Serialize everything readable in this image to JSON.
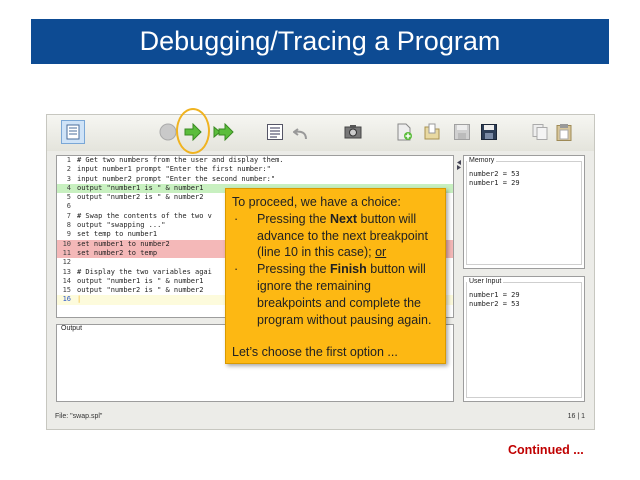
{
  "slide": {
    "title": "Debugging/Tracing a Program",
    "continued": "Continued ..."
  },
  "toolbar": {
    "icons": [
      "list-view-icon",
      "stop-icon",
      "next-icon",
      "finish-icon",
      "source-listing-icon",
      "undo-icon",
      "screenshot-icon",
      "new-file-icon",
      "open-file-icon",
      "save-icon",
      "save-as-icon",
      "copy-icon",
      "paste-icon"
    ],
    "highlighted": "next-icon",
    "highlight_color": "#f0b320"
  },
  "editor": {
    "lines": [
      {
        "n": "1",
        "text": "# Get two numbers from the user and display them.",
        "hl": ""
      },
      {
        "n": "2",
        "text": "input number1 prompt \"Enter the first number:\"",
        "hl": ""
      },
      {
        "n": "3",
        "text": "input number2 prompt \"Enter the second number:\"",
        "hl": ""
      },
      {
        "n": "4",
        "text": "output \"number1 is \" & number1",
        "hl": "green"
      },
      {
        "n": "5",
        "text": "output \"number2 is \" & number2",
        "hl": ""
      },
      {
        "n": "6",
        "text": "",
        "hl": ""
      },
      {
        "n": "7",
        "text": "# Swap the contents of the two v",
        "hl": ""
      },
      {
        "n": "8",
        "text": "output \"swapping ...\"",
        "hl": ""
      },
      {
        "n": "9",
        "text": "set temp to number1",
        "hl": ""
      },
      {
        "n": "10",
        "text": "set number1 to number2",
        "hl": "red"
      },
      {
        "n": "11",
        "text": "set number2 to temp",
        "hl": "red"
      },
      {
        "n": "12",
        "text": "",
        "hl": ""
      },
      {
        "n": "13",
        "text": "# Display the two variables agai",
        "hl": ""
      },
      {
        "n": "14",
        "text": "output \"number1 is \" & number1",
        "hl": ""
      },
      {
        "n": "15",
        "text": "output \"number2 is \" & number2",
        "hl": ""
      },
      {
        "n": "16",
        "text": "|",
        "hl": "current"
      }
    ],
    "colors": {
      "green": "#c8f0c0",
      "red": "#f4b8b8",
      "current": "#fdfbdc"
    }
  },
  "output_pane": {
    "label": "Output"
  },
  "memory_pane": {
    "label": "Memory",
    "content": "number2 = 53\nnumber1 = 29"
  },
  "user_input_pane": {
    "label": "User Input",
    "content": "number1 = 29\nnumber2 = 53"
  },
  "status": {
    "file": "File: \"swap.spl\"",
    "position": "16 | 1"
  },
  "callout": {
    "intro": "To proceed, we have a choice:",
    "bullet1_pre": "Pressing the ",
    "bullet1_bold": "Next",
    "bullet1_mid": " button will advance to the next breakpoint (line 10 in this case); ",
    "bullet1_or": "or",
    "bullet2_pre": "Pressing the ",
    "bullet2_bold": "Finish",
    "bullet2_post": " button will ignore the remaining breakpoints and complete the program without pausing again.",
    "outro": "Let’s choose the first option ...",
    "bullet_char": "·",
    "bg": "#fdb813"
  }
}
